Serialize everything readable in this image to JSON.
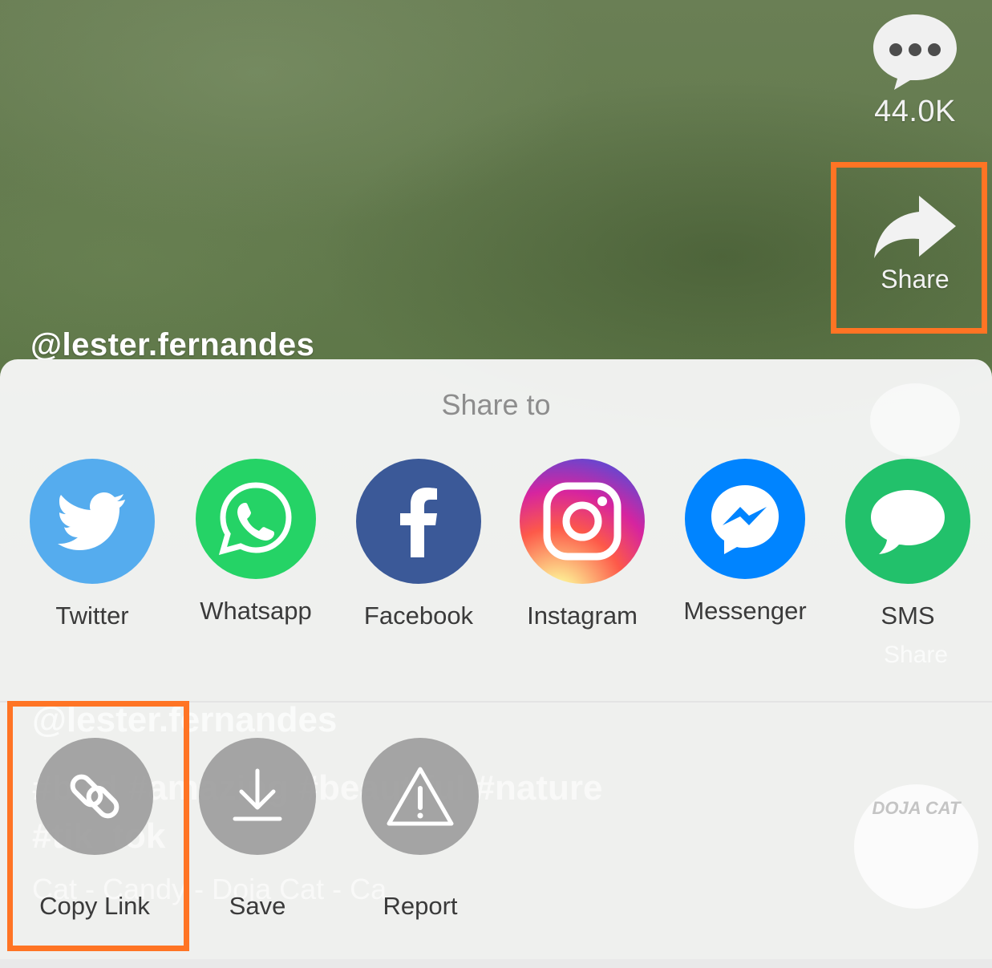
{
  "video": {
    "username": "@lester.fernandes",
    "comment_count": "44.0K",
    "share_label": "Share",
    "ghost_hashtags": "#bird #amazing #beautiful #nature #tik_tok",
    "ghost_music": "Cat - Candy - Doja Cat - Ca",
    "ghost_disc_text": "DOJA CAT"
  },
  "share_sheet": {
    "title": "Share to",
    "targets": [
      {
        "label": "Twitter",
        "icon": "twitter-icon",
        "color": "#55acee"
      },
      {
        "label": "Whatsapp",
        "icon": "whatsapp-icon",
        "color": "#25d366"
      },
      {
        "label": "Facebook",
        "icon": "facebook-icon",
        "color": "#3b5998"
      },
      {
        "label": "Instagram",
        "icon": "instagram-icon",
        "color": "#c13584"
      },
      {
        "label": "Messenger",
        "icon": "messenger-icon",
        "color": "#0084ff"
      },
      {
        "label": "SMS",
        "icon": "sms-icon",
        "color": "#22c16b"
      }
    ],
    "actions": [
      {
        "label": "Copy Link",
        "icon": "link-icon"
      },
      {
        "label": "Save",
        "icon": "download-icon"
      },
      {
        "label": "Report",
        "icon": "warning-icon"
      }
    ]
  },
  "colors": {
    "highlight": "#ff7424",
    "sheet_background": "#f6f6f6",
    "action_circle": "#969696"
  }
}
